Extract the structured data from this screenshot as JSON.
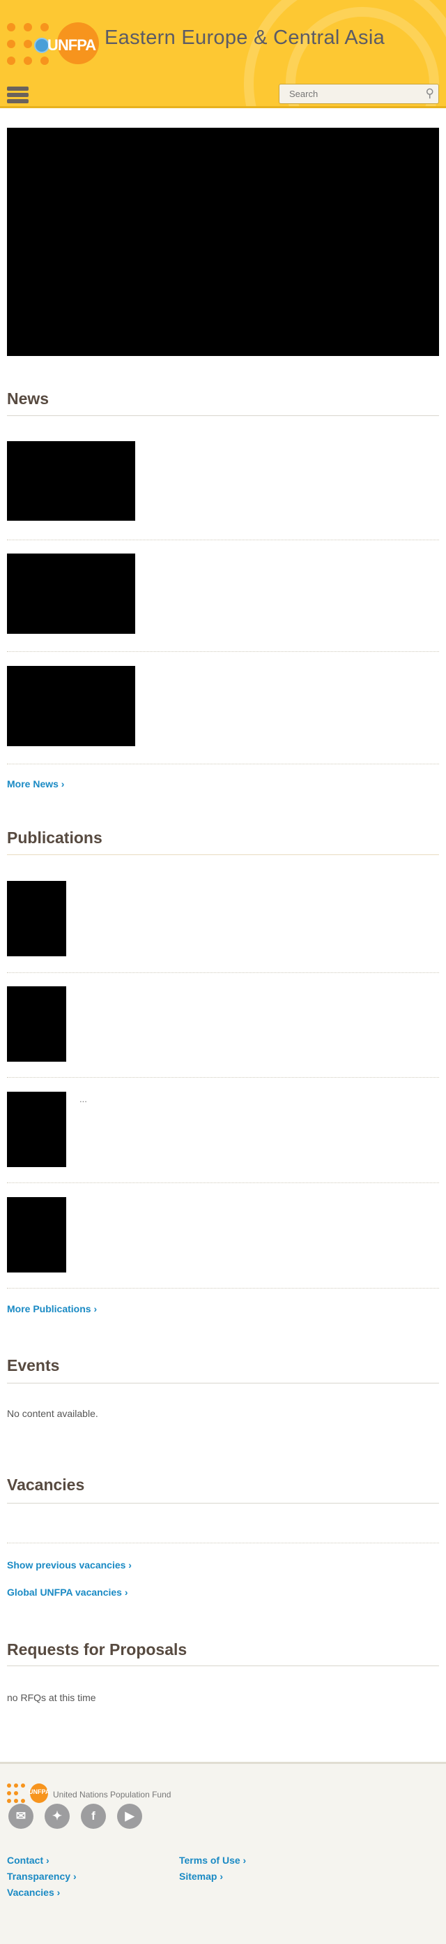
{
  "header": {
    "region_title": "Eastern Europe & Central Asia",
    "logo_text": "UNFPA",
    "search_placeholder": "Search"
  },
  "news": {
    "heading": "News",
    "more_label": "More News ›"
  },
  "publications": {
    "heading": "Publications",
    "item3_text": "...",
    "more_label": "More Publications ›"
  },
  "events": {
    "heading": "Events",
    "empty_text": "No content available."
  },
  "vacancies": {
    "heading": "Vacancies",
    "show_previous": "Show previous vacancies ›",
    "global": "Global UNFPA vacancies ›"
  },
  "rfp": {
    "heading": "Requests for Proposals",
    "empty_text": "no RFQs at this time"
  },
  "footer": {
    "org_name": "United Nations Population Fund",
    "logo_text": "UNFPA",
    "social": [
      "email-icon",
      "twitter-icon",
      "facebook-icon",
      "youtube-icon"
    ],
    "links_left": [
      "Contact ›",
      "Transparency ›",
      "Vacancies ›"
    ],
    "links_right": [
      "Terms of Use ›",
      "Sitemap ›"
    ]
  },
  "colors": {
    "header_bg": "#fdc833",
    "accent_orange": "#f7941d",
    "link_blue": "#1a8ac4",
    "heading": "#574a40"
  }
}
